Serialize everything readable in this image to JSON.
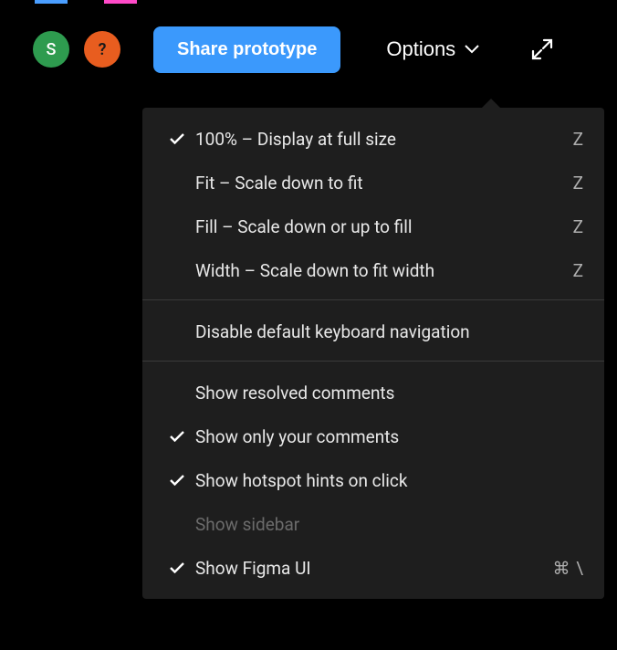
{
  "toolbar": {
    "avatar_letter": "S",
    "help_symbol": "?",
    "share_label": "Share prototype",
    "options_label": "Options"
  },
  "menu": {
    "groups": [
      {
        "items": [
          {
            "label": "100% – Display at full size",
            "shortcut": "Z",
            "checked": true,
            "disabled": false
          },
          {
            "label": "Fit – Scale down to fit",
            "shortcut": "Z",
            "checked": false,
            "disabled": false
          },
          {
            "label": "Fill – Scale down or up to fill",
            "shortcut": "Z",
            "checked": false,
            "disabled": false
          },
          {
            "label": "Width – Scale down to fit width",
            "shortcut": "Z",
            "checked": false,
            "disabled": false
          }
        ]
      },
      {
        "items": [
          {
            "label": "Disable default keyboard navigation",
            "shortcut": "",
            "checked": false,
            "disabled": false
          }
        ]
      },
      {
        "items": [
          {
            "label": "Show resolved comments",
            "shortcut": "",
            "checked": false,
            "disabled": false
          },
          {
            "label": "Show only your comments",
            "shortcut": "",
            "checked": true,
            "disabled": false
          },
          {
            "label": "Show hotspot hints on click",
            "shortcut": "",
            "checked": true,
            "disabled": false
          },
          {
            "label": "Show sidebar",
            "shortcut": "",
            "checked": false,
            "disabled": true
          },
          {
            "label": "Show Figma UI",
            "shortcut": "⌘ \\",
            "checked": true,
            "disabled": false
          }
        ]
      }
    ]
  }
}
